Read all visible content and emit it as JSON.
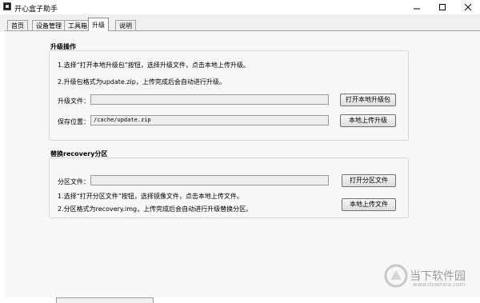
{
  "window": {
    "title": "开心盒子助手"
  },
  "tabs": [
    {
      "label": "首页"
    },
    {
      "label": "设备管理"
    },
    {
      "label": "工具箱"
    },
    {
      "label": "升级"
    },
    {
      "label": "说明"
    }
  ],
  "upgrade_section": {
    "title": "升级操作",
    "instruction_1": "1.选择“打开本地升级包”按钮，选择升级文件，点击本地上传升级。",
    "instruction_2": "2.升级包格式为update.zip，上传完成后会自动进行升级。",
    "file_label": "升级文件：",
    "file_value": "",
    "open_button": "打开本地升级包",
    "save_label": "保存位置：",
    "save_value": "/cache/update.zip",
    "upload_button": "本地上传升级"
  },
  "recovery_section": {
    "title": "替换recovery分区",
    "file_label": "分区文件：",
    "file_value": "",
    "open_button": "打开分区文件",
    "instruction_1": "1.选择“打开分区文件”按钮，选择镜像文件，点击本地上传文件。",
    "instruction_2": "2.分区格式为recovery.img，上传完成后会自动进行升级替换分区。",
    "upload_button": "本地上传文件"
  },
  "watermark": {
    "name": "当下软件园",
    "url": "www.downxia.com"
  }
}
